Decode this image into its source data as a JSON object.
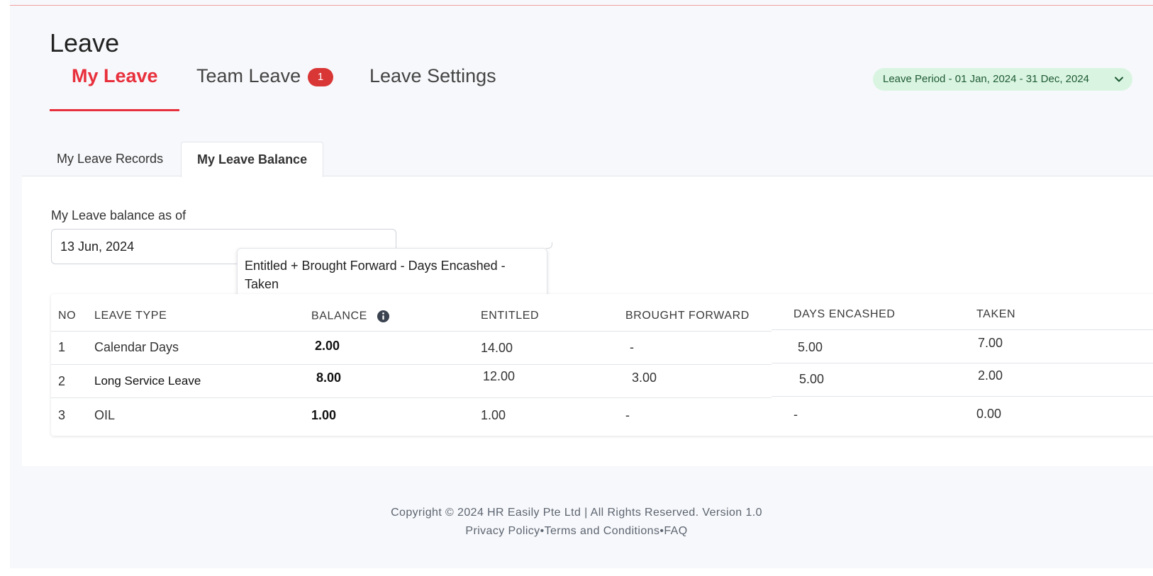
{
  "header": {
    "title": "Leave",
    "tabs": [
      {
        "label": "My Leave"
      },
      {
        "label": "Team Leave",
        "badge": "1"
      },
      {
        "label": "Leave Settings"
      }
    ],
    "leave_period": "Leave Period - 01 Jan, 2024 - 31 Dec, 2024"
  },
  "subtabs": [
    {
      "label": "My Leave Records"
    },
    {
      "label": "My Leave Balance"
    }
  ],
  "balance_form": {
    "label": "My Leave balance as of",
    "date_value": "13 Jun, 2024"
  },
  "tooltip": {
    "line1": "Entitled + Brought Forward - Days Encashed -",
    "line2": "Taken"
  },
  "table": {
    "headers": [
      "NO",
      "LEAVE TYPE",
      "BALANCE",
      "ENTITLED",
      "BROUGHT FORWARD",
      "DAYS ENCASHED",
      "TAKEN"
    ],
    "rows": [
      {
        "no": "1",
        "type": "Calendar Days",
        "balance": "2.00",
        "entitled": "14.00",
        "brought_forward": "-",
        "encashed": "5.00",
        "taken": "7.00"
      },
      {
        "no": "2",
        "type": "Long Service Leave",
        "balance": "8.00",
        "entitled": "12.00",
        "brought_forward": "3.00",
        "encashed": "5.00",
        "taken": "2.00"
      },
      {
        "no": "3",
        "type": "OIL",
        "balance": "1.00",
        "entitled": "1.00",
        "brought_forward": "-",
        "encashed": "-",
        "taken": "0.00"
      }
    ]
  },
  "footer": {
    "copyright": "Copyright © 2024 HR Easily Pte Ltd | All Rights Reserved. Version 1.0",
    "links": [
      "Privacy Policy",
      "Terms and Conditions",
      "FAQ"
    ],
    "separator": "•"
  },
  "colors": {
    "accent": "#e8303c",
    "badge": "#d93636",
    "period_bg": "#d9f5e2",
    "period_text": "#1f5a33"
  }
}
